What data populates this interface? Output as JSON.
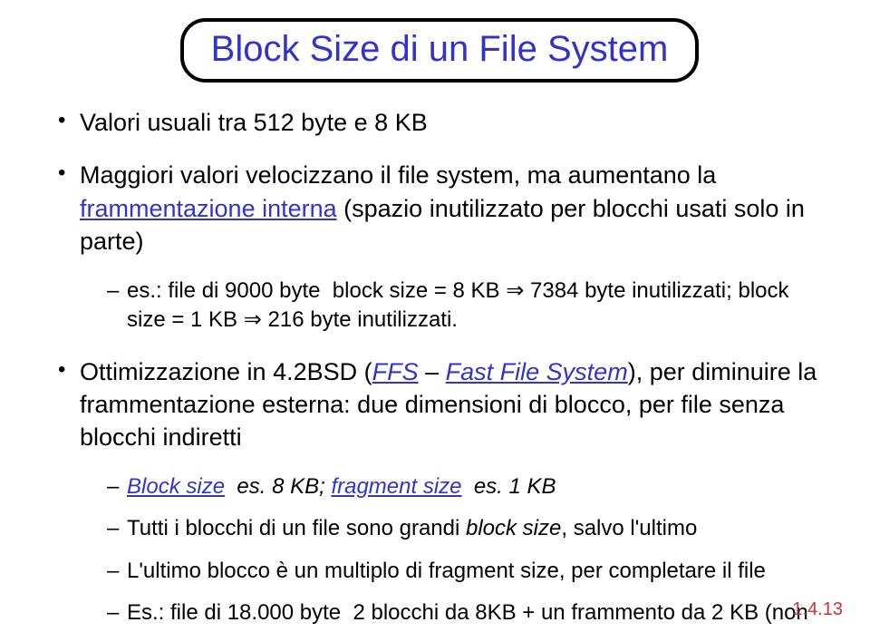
{
  "title": "Block Size di un File System",
  "bullets": {
    "b1": "Valori usuali tra 512 byte e 8 KB",
    "b2_pre": "Maggiori valori velocizzano il file system, ma aumentano la ",
    "b2_link": "frammentazione interna",
    "b2_post": " (spazio inutilizzato per blocchi usati solo in parte)",
    "b2_sub": "es.: file di 9000 byte ­ block size = 8 KB ⇒ 7384 byte inutilizzati; block size = 1 KB ⇒ 216 byte inutilizzati.",
    "b3_pre": "Ottimizzazione in 4.2BSD (",
    "b3_ffs": "FFS",
    "b3_dash": " – ",
    "b3_fast": "Fast File System",
    "b3_post": "), per diminuire la frammentazione esterna: due dimensioni di blocco, per file senza blocchi indiretti",
    "b3s1_bs": "Block size",
    "b3s1_mid": " ­ es. 8 KB; ",
    "b3s1_fs": "fragment size",
    "b3s1_end": " ­ es. 1 KB",
    "b3s2_a": "Tutti i blocchi di un file sono grandi ",
    "b3s2_b": "block size",
    "b3s2_c": ", salvo l'ultimo",
    "b3s3": "L'ultimo blocco è un multiplo di fragment size, per completare il file",
    "b3s4": "Es.: file di 18.000 byte ­ 2 blocchi da 8KB + un frammento da 2 KB (non"
  },
  "pagenum": "1.4.13"
}
